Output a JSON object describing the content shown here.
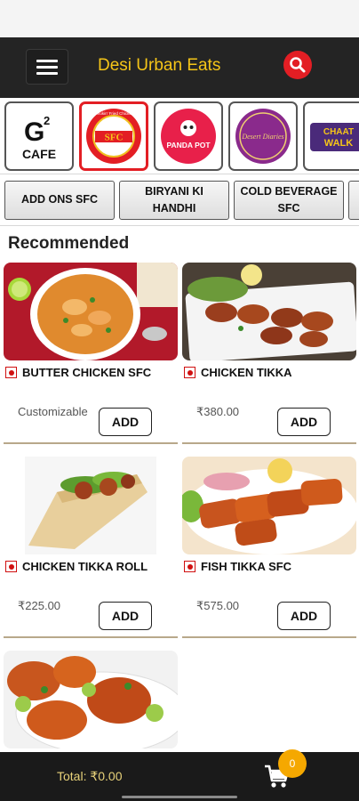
{
  "header": {
    "title": "Desi Urban Eats",
    "menu_icon": "hamburger-menu-icon",
    "search_icon": "search-icon",
    "accent": "#f5c518",
    "search_color": "#e31e24"
  },
  "brands": [
    {
      "name": "G2 Cafe",
      "line1": "G",
      "sup": "2",
      "line2": "CAFE"
    },
    {
      "name": "SFC",
      "ring_top": "Smokin' Fried Chicken",
      "center": "SFC",
      "active": true
    },
    {
      "name": "Panda Pot",
      "text": "PANDA POT"
    },
    {
      "name": "Desert Diaries",
      "text": "Desert Diaries"
    },
    {
      "name": "Chaat Walk",
      "line1": "CHAAT",
      "line2": "WALK"
    }
  ],
  "categories": [
    {
      "label": "ADD ONS SFC"
    },
    {
      "label": "BIRYANI KI HANDHI"
    },
    {
      "label": "COLD BEVERAGE SFC"
    }
  ],
  "section": {
    "title": "Recommended"
  },
  "items": [
    {
      "name": "BUTTER CHICKEN SFC",
      "price": "Customizable",
      "button": "ADD"
    },
    {
      "name": "CHICKEN TIKKA",
      "price": "₹380.00",
      "button": "ADD"
    },
    {
      "name": "CHICKEN TIKKA ROLL",
      "price": "₹225.00",
      "button": "ADD"
    },
    {
      "name": "FISH TIKKA SFC",
      "price": "₹575.00",
      "button": "ADD"
    }
  ],
  "footer": {
    "total": "Total: ₹0.00",
    "cart_icon": "cart-icon",
    "cart_count": "0"
  }
}
